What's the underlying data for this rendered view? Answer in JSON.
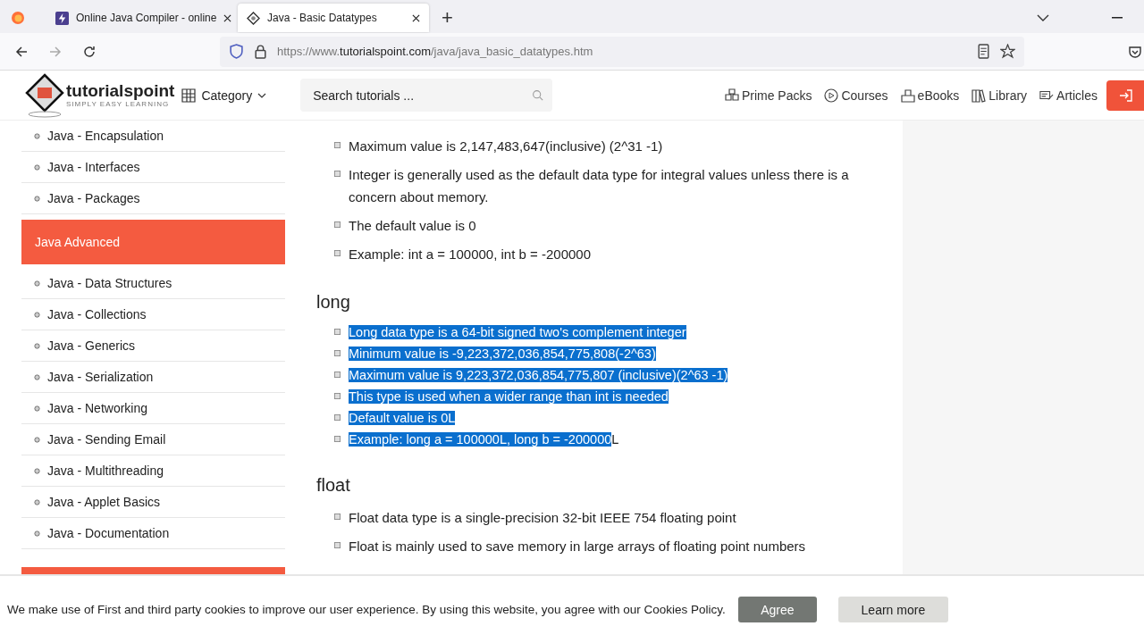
{
  "browser": {
    "tabs": [
      {
        "title": "Online Java Compiler - online",
        "selected": false
      },
      {
        "title": "Java - Basic Datatypes",
        "selected": true
      }
    ],
    "new_tab": "+",
    "url_host": "https://www.",
    "url_domain": "tutorialspoint.com",
    "url_path": "/java/java_basic_datatypes.htm"
  },
  "site_header": {
    "logo": "tutorialspoint",
    "tagline": "SIMPLY EASY LEARNING",
    "category": "Category",
    "search": {
      "placeholder": "Search tutorials ..."
    },
    "nav": [
      {
        "label": "Prime Packs"
      },
      {
        "label": "Courses"
      },
      {
        "label": "eBooks"
      },
      {
        "label": "Library"
      },
      {
        "label": "Articles"
      }
    ]
  },
  "sidebar": [
    {
      "kind": "item",
      "label": "Java - Encapsulation"
    },
    {
      "kind": "item",
      "label": "Java - Interfaces"
    },
    {
      "kind": "item",
      "label": "Java - Packages"
    },
    {
      "kind": "section",
      "label": "Java Advanced"
    },
    {
      "kind": "item",
      "label": "Java - Data Structures"
    },
    {
      "kind": "item",
      "label": "Java - Collections"
    },
    {
      "kind": "item",
      "label": "Java - Generics"
    },
    {
      "kind": "item",
      "label": "Java - Serialization"
    },
    {
      "kind": "item",
      "label": "Java - Networking"
    },
    {
      "kind": "item",
      "label": "Java - Sending Email"
    },
    {
      "kind": "item",
      "label": "Java - Multithreading"
    },
    {
      "kind": "item",
      "label": "Java - Applet Basics"
    },
    {
      "kind": "item",
      "label": "Java - Documentation"
    }
  ],
  "content": [
    {
      "kind": "list",
      "items": [
        {
          "parts": [
            {
              "text": "Maximum value is 2,147,483,647(inclusive) (2^31 -1)",
              "selected": false
            }
          ]
        },
        {
          "parts": [
            {
              "text": "Integer is generally used as the default data type for integral values unless there is a concern about memory.",
              "selected": false
            }
          ]
        },
        {
          "parts": [
            {
              "text": "The default value is 0",
              "selected": false
            }
          ]
        },
        {
          "parts": [
            {
              "text": "Example: int a = 100000, int b = -200000",
              "selected": false
            }
          ]
        }
      ]
    },
    {
      "kind": "heading",
      "text": "long"
    },
    {
      "kind": "list",
      "items": [
        {
          "parts": [
            {
              "text": "Long data type is a 64-bit signed two's complement integer",
              "selected": true
            }
          ]
        },
        {
          "parts": [
            {
              "text": "Minimum value is -9,223,372,036,854,775,808(-2^63)",
              "selected": true
            }
          ]
        },
        {
          "parts": [
            {
              "text": "Maximum value is 9,223,372,036,854,775,807 (inclusive)(2^63 -1)",
              "selected": true
            }
          ]
        },
        {
          "parts": [
            {
              "text": "This type is used when a wider range than int is needed",
              "selected": true
            }
          ]
        },
        {
          "parts": [
            {
              "text": "Default value is 0L",
              "selected": true
            }
          ]
        },
        {
          "parts": [
            {
              "text": "Example: long a = 100000L, long b = -200000",
              "selected": true
            },
            {
              "text": "L",
              "selected": false
            }
          ]
        }
      ]
    },
    {
      "kind": "heading",
      "text": "float"
    },
    {
      "kind": "list",
      "items": [
        {
          "parts": [
            {
              "text": "Float data type is a single-precision 32-bit IEEE 754 floating point",
              "selected": false
            }
          ]
        },
        {
          "parts": [
            {
              "text": "Float is mainly used to save memory in large arrays of floating point numbers",
              "selected": false
            }
          ]
        }
      ]
    }
  ],
  "cookie_bar": {
    "message": "We make use of First and third party cookies to improve our user experience. By using this website, you agree with our Cookies Policy.",
    "agree": "Agree",
    "learn_more": "Learn more"
  }
}
